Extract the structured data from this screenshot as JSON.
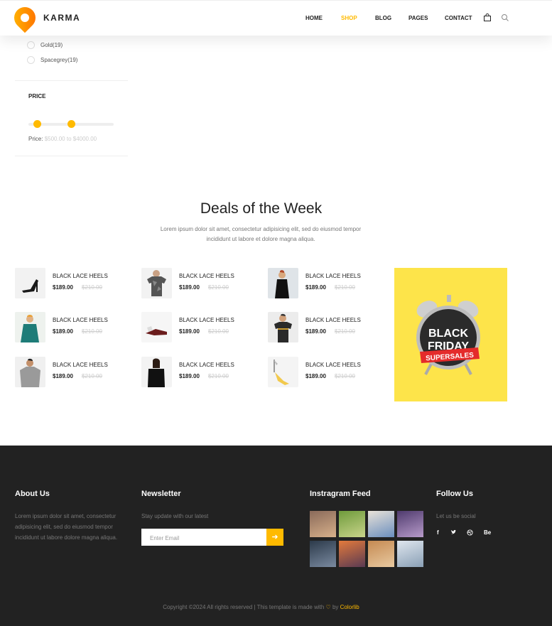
{
  "brand": {
    "name": "KARMA"
  },
  "nav": {
    "items": [
      "HOME",
      "SHOP",
      "BLOG",
      "PAGES",
      "CONTACT"
    ],
    "active": "SHOP"
  },
  "filters": {
    "colors": [
      "Gold(19)",
      "Spacegrey(19)"
    ],
    "price": {
      "title": "PRICE",
      "label": "Price:",
      "from": "$500.00",
      "to_word": "to",
      "to": "$4000.00"
    }
  },
  "deals": {
    "title": "Deals of the Week",
    "description_line1": "Lorem ipsum dolor sit amet, consectetur adipisicing elit, sed do eiusmod tempor",
    "description_line2": "incididunt ut labore et dolore magna aliqua.",
    "products": [
      {
        "name": "BLACK LACE HEELS",
        "price": "$189.00",
        "old_price": "$210.00",
        "image": "heels"
      },
      {
        "name": "BLACK LACE HEELS",
        "price": "$189.00",
        "old_price": "$210.00",
        "image": "camo-tshirt"
      },
      {
        "name": "BLACK LACE HEELS",
        "price": "$189.00",
        "old_price": "$210.00",
        "image": "black-dress"
      },
      {
        "name": "BLACK LACE HEELS",
        "price": "$189.00",
        "old_price": "$210.00",
        "image": "teal-dress"
      },
      {
        "name": "BLACK LACE HEELS",
        "price": "$189.00",
        "old_price": "$210.00",
        "image": "flats"
      },
      {
        "name": "BLACK LACE HEELS",
        "price": "$189.00",
        "old_price": "$210.00",
        "image": "polo-shirt"
      },
      {
        "name": "BLACK LACE HEELS",
        "price": "$189.00",
        "old_price": "$210.00",
        "image": "grey-sweater"
      },
      {
        "name": "BLACK LACE HEELS",
        "price": "$189.00",
        "old_price": "$210.00",
        "image": "lace-top"
      },
      {
        "name": "BLACK LACE HEELS",
        "price": "$189.00",
        "old_price": "$210.00",
        "image": "yellow-heels"
      }
    ],
    "promo": {
      "line1": "BLACK",
      "line2": "FRIDAY",
      "ribbon": "SUPERSALES"
    }
  },
  "footer": {
    "about": {
      "title": "About Us",
      "text_line1": "Lorem ipsum dolor sit amet, consectetur",
      "text_line2": "adipisicing elit, sed do eiusmod tempor",
      "text_line3": "incididunt ut labore dolore magna aliqua."
    },
    "newsletter": {
      "title": "Newsletter",
      "text": "Stay update with our latest",
      "placeholder": "Enter Email",
      "submit_icon": "arrow-right-icon"
    },
    "instagram": {
      "title": "Instragram Feed"
    },
    "follow": {
      "title": "Follow Us",
      "text": "Let us be social",
      "icons": [
        "f",
        "twitter-bird",
        "dribbble",
        "Be"
      ],
      "be_label": "Be",
      "fb_label": "f"
    },
    "copyright_prefix": "Copyright ©2024 All rights reserved | This template is made with",
    "copyright_by": "by",
    "copyright_brand": "Colorlib"
  },
  "colors": {
    "accent": "#ffba00",
    "footer_bg": "#222222"
  }
}
